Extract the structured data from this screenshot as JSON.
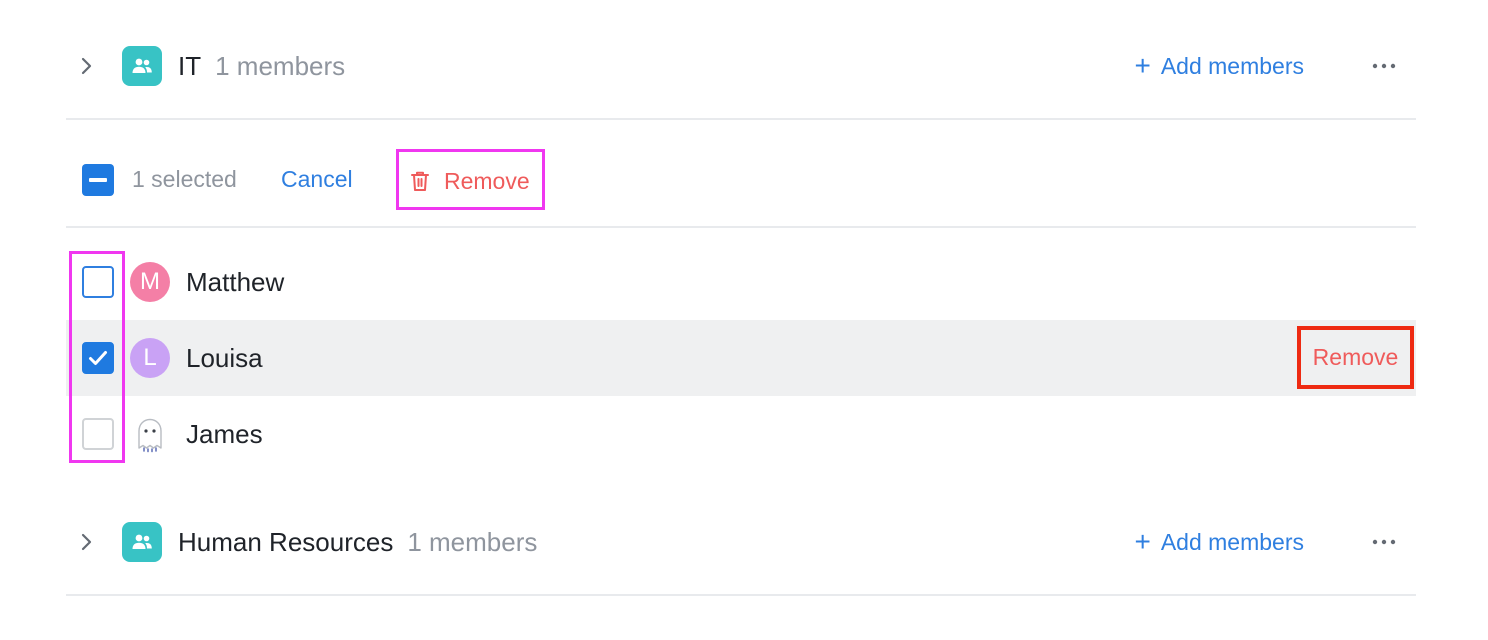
{
  "groups": [
    {
      "name": "IT",
      "count": "1 members",
      "add_label": "Add members"
    },
    {
      "name": "Human Resources",
      "count": "1 members",
      "add_label": "Add members"
    }
  ],
  "toolbar": {
    "selected_text": "1 selected",
    "cancel_label": "Cancel",
    "remove_label": "Remove"
  },
  "members": [
    {
      "initial": "M",
      "name": "Matthew",
      "avatar_color": "#f47fa6",
      "checked": false
    },
    {
      "initial": "L",
      "name": "Louisa",
      "avatar_color": "#c9a2f5",
      "checked": true,
      "remove_label": "Remove"
    },
    {
      "initial": "",
      "name": "James",
      "avatar_icon": "ghost-icon",
      "checked": false
    }
  ],
  "colors": {
    "accent": "#1f7ae0",
    "link": "#2f7fe0",
    "danger": "#ef5b5b",
    "group_icon": "#38c3c5",
    "highlight_magenta": "#f037f0",
    "highlight_red": "#ee2a12"
  }
}
